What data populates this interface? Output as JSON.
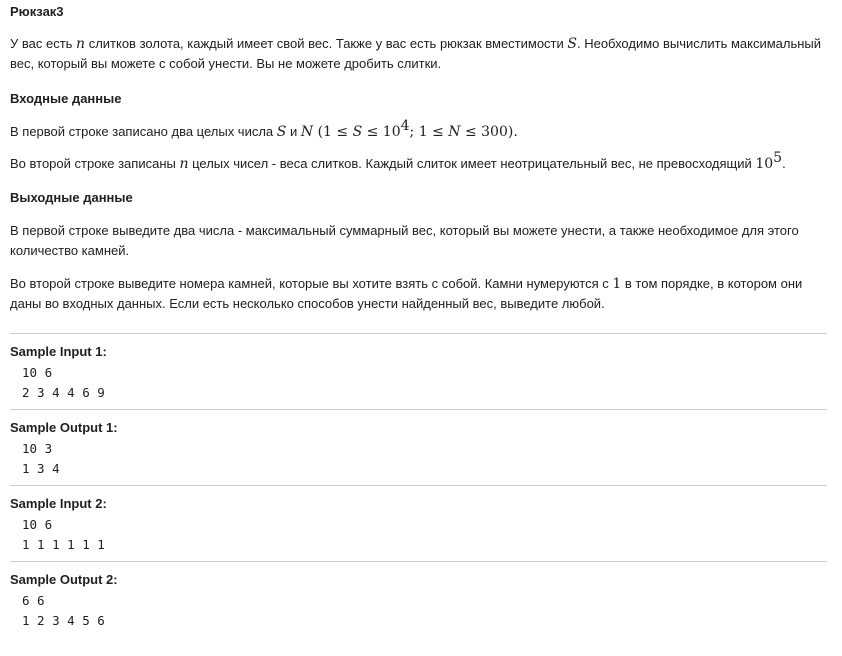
{
  "problem": {
    "title": "Рюкзак3",
    "statement": {
      "p1_a": "У вас есть ",
      "var_n": "n",
      "p1_b": " слитков золота, каждый имеет свой вес. Также у вас есть рюкзак вместимости ",
      "var_S": "S",
      "p1_c": ". Необходимо вычислить максимальный вес, который вы можете с собой унести. Вы не можете дробить слитки."
    },
    "input_section": {
      "heading": "Входные данные",
      "line1_a": "В первой строке записано два целых числа ",
      "line1_S": "S",
      "line1_and": " и ",
      "line1_N": "N",
      "line1_constraint_a": " (1 ≤ ",
      "line1_constraint_S": "S",
      "line1_constraint_b": " ≤ 10",
      "line1_constraint_exp": "4",
      "line1_constraint_c": "; 1 ≤ ",
      "line1_constraint_N": "N",
      "line1_constraint_d": " ≤ 300).",
      "line2_a": "Во второй строке записаны ",
      "line2_n": "n",
      "line2_b": " целых чисел - веса слитков. Каждый слиток имеет неотрицательный вес, не превосходящий ",
      "line2_base": "10",
      "line2_exp": "5",
      "line2_end": "."
    },
    "output_section": {
      "heading": "Выходные данные",
      "line1": "В первой строке выведите два числа - максимальный суммарный вес, который вы можете унести, а также необходимое для этого количество камней.",
      "line2_a": "Во второй строке выведите номера камней, которые вы хотите взять с собой. Камни нумеруются с ",
      "line2_one": "1",
      "line2_b": " в том порядке, в котором они даны во входных данных. Если есть несколько способов унести найденный вес, выведите любой."
    }
  },
  "samples": [
    {
      "label": "Sample Input 1:",
      "lines": [
        "10 6",
        "2 3 4 4 6 9"
      ]
    },
    {
      "label": "Sample Output 1:",
      "lines": [
        "10 3",
        "1 3 4"
      ]
    },
    {
      "label": "Sample Input 2:",
      "lines": [
        "10 6",
        "1 1 1 1 1 1"
      ]
    },
    {
      "label": "Sample Output 2:",
      "lines": [
        "6 6",
        "1 2 3 4 5 6"
      ]
    }
  ]
}
